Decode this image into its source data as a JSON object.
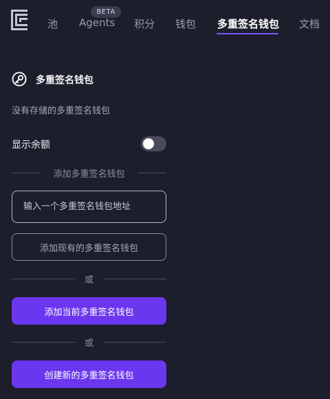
{
  "nav": {
    "items": [
      {
        "label": "池"
      },
      {
        "label": "Agents"
      },
      {
        "label": "积分"
      },
      {
        "label": "钱包"
      },
      {
        "label": "多重签名钱包"
      },
      {
        "label": "文档"
      }
    ],
    "beta_badge": "BETA",
    "active_index": 4,
    "logo_icon": "logo-icon"
  },
  "section": {
    "icon": "key-circle-icon",
    "title": "多重签名钱包",
    "empty_text": "没有存储的多重签名钱包",
    "show_balance_label": "显示余额",
    "show_balance_on": false,
    "divider_add": "添加多重签名钱包",
    "address_input_placeholder": "输入一个多重签名钱包地址",
    "add_existing_label": "添加现有的多重签名钱包",
    "or_1": "或",
    "add_current_label": "添加当前多重签名钱包",
    "or_2": "或",
    "create_new_label": "创建新的多重签名钱包"
  },
  "colors": {
    "background": "#1d1e2c",
    "accent": "#6b37ee",
    "underline": "#7a56ff"
  }
}
